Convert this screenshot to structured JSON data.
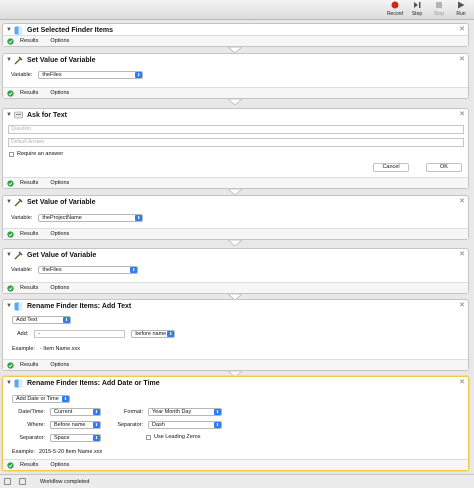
{
  "toolbar": {
    "buttons": [
      {
        "label": "Record",
        "icon": "record-icon",
        "color": "#d3261b"
      },
      {
        "label": "Step",
        "icon": "step-icon"
      },
      {
        "label": "Stop",
        "icon": "stop-icon"
      },
      {
        "label": "Run",
        "icon": "run-icon"
      }
    ]
  },
  "footer_tabs": {
    "results": "Results",
    "options": "Options"
  },
  "actions": {
    "a1": {
      "title": "Get Selected Finder Items"
    },
    "a2": {
      "title": "Set Value of Variable",
      "variable_label": "Variable:",
      "variable_value": "theFiles"
    },
    "a3": {
      "title": "Ask for Text",
      "question_placeholder": "Question",
      "default_answer_placeholder": "Default Answer",
      "require_label": "Require an answer",
      "cancel_label": "Cancel",
      "ok_label": "OK"
    },
    "a4": {
      "title": "Set Value of Variable",
      "variable_label": "Variable:",
      "variable_value": "theProjectName"
    },
    "a5": {
      "title": "Get Value of Variable",
      "variable_label": "Variable:",
      "variable_value": "theFiles"
    },
    "a6": {
      "title": "Rename Finder Items: Add Text",
      "mode_value": "Add Text",
      "add_label": "Add:",
      "add_value": "-",
      "position_value": "before name",
      "example_label": "Example:",
      "example_value": "- Item Name.xxx"
    },
    "a7": {
      "title": "Rename Finder Items: Add Date or Time",
      "mode_value": "Add Date or Time",
      "datetime_label": "Date/Time:",
      "datetime_value": "Current",
      "where_label": "Where:",
      "where_value": "Before name",
      "separator_label": "Separator:",
      "separator_value": "Space",
      "format_label": "Format:",
      "format_value": "Year Month Day",
      "separator2_label": "Separator:",
      "separator2_value": "Dash",
      "leading_zeros_label": "Use Leading Zeros",
      "example_label": "Example:",
      "example_value": "2015-5-20 Item Name.xxx"
    }
  },
  "status": {
    "text": "Workflow completed"
  },
  "colors": {
    "accent": "#2f7cf6",
    "success": "#2ea043",
    "selected_border": "#f2c94c"
  }
}
